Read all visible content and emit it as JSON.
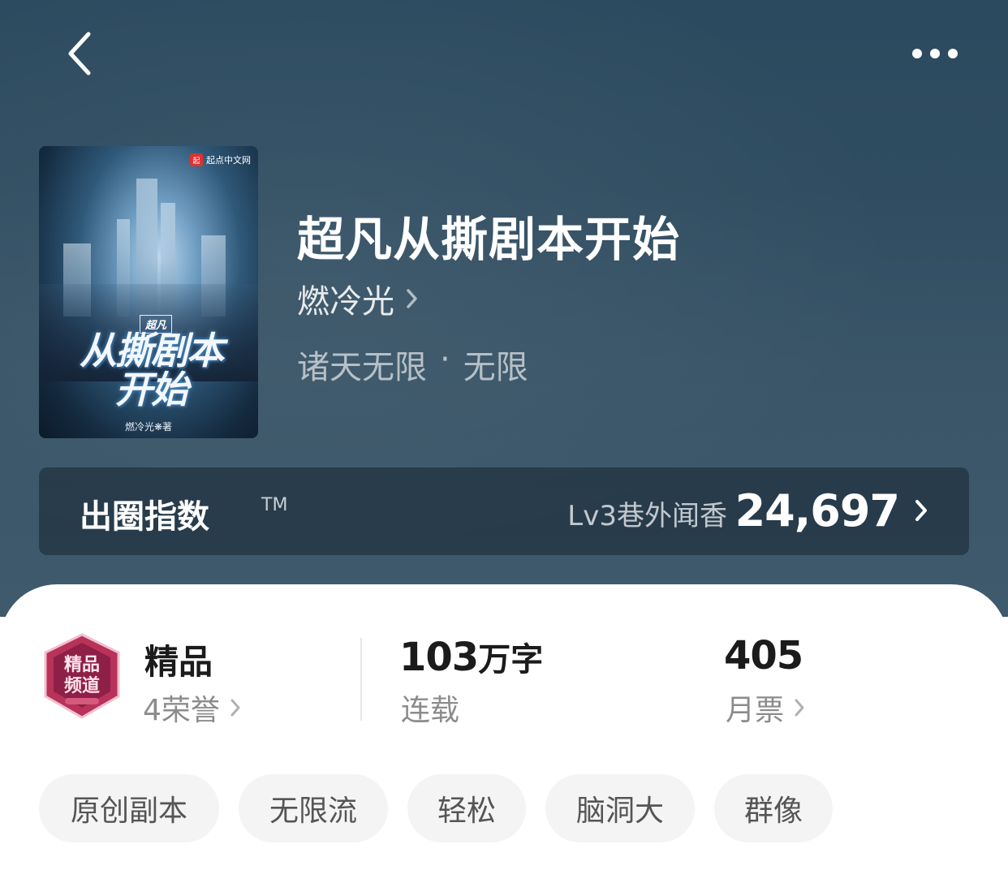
{
  "nav": {
    "back_icon": "chevron-left-icon",
    "more_icon": "more-horizontal-icon"
  },
  "book": {
    "title": "超凡从撕剧本开始",
    "author": "燃冷光",
    "genre": "诸天无限",
    "subgenre": "无限",
    "separator": "·",
    "cover": {
      "publisher": "起点中文网",
      "publisher_logo": "起",
      "subtitle": "超凡",
      "title_line1": "从撕剧本",
      "title_line2": "开始",
      "author_credit": "燃冷光❋著"
    }
  },
  "index_bar": {
    "label": "出圈指数",
    "tm": "TM",
    "level": "Lv3巷外闻香",
    "value": "24,697"
  },
  "stats": {
    "honor": {
      "badge_text_top": "精品",
      "badge_text_bottom": "频道",
      "title": "精品",
      "count": "4荣誉"
    },
    "words": {
      "number": "103",
      "unit": "万字",
      "status": "连载"
    },
    "tickets": {
      "value": "405",
      "label": "月票"
    }
  },
  "tags": [
    "原创副本",
    "无限流",
    "轻松",
    "脑洞大",
    "群像"
  ],
  "colors": {
    "hero_bg": "#2f4c60",
    "panel_bg": "#ffffff",
    "tag_bg": "#f4f4f4",
    "badge": "#b8325a"
  }
}
